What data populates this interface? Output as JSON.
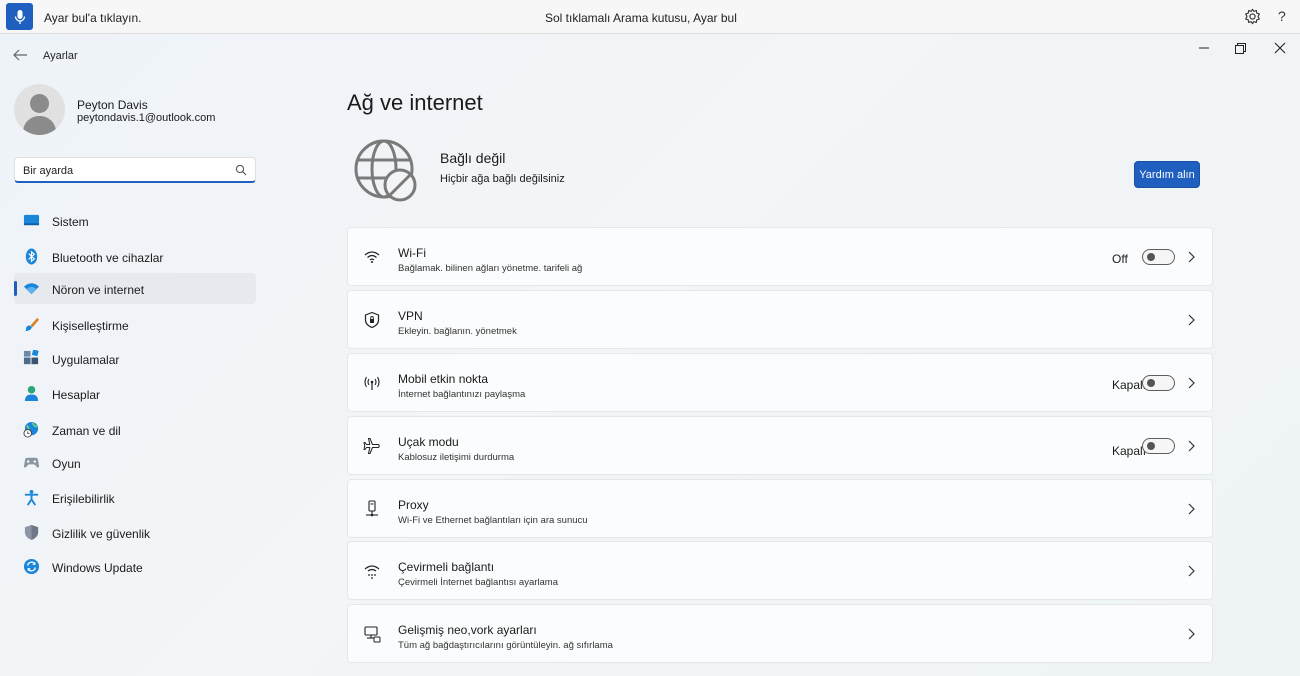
{
  "voice_bar": {
    "status_text": "Ayar bul'a tıklayın.",
    "center_text": "Sol tıklamalı Arama kutusu, Ayar bul",
    "help_label": "?"
  },
  "window": {
    "title": "Ayarlar"
  },
  "profile": {
    "name": "Peyton Davis",
    "email": "peytondavis.1@outlook.com"
  },
  "search": {
    "value": "Bir ayarda"
  },
  "sidebar": {
    "items": [
      {
        "label": "Sistem",
        "icon": "monitor-icon"
      },
      {
        "label": "Bluetooth ve cihazlar",
        "icon": "bluetooth-icon"
      },
      {
        "label": "Nöron ve internet",
        "icon": "wifi-icon",
        "active": true
      },
      {
        "label": "Kişiselleştirme",
        "icon": "brush-icon"
      },
      {
        "label": "Uygulamalar",
        "icon": "apps-icon"
      },
      {
        "label": "Hesaplar",
        "icon": "person-icon"
      },
      {
        "label": "Zaman ve dil",
        "icon": "globe-clock-icon"
      },
      {
        "label": "Oyun",
        "icon": "gamepad-icon"
      },
      {
        "label": "Erişilebilirlik",
        "icon": "accessibility-icon"
      },
      {
        "label": "Gizlilik ve güvenlik",
        "icon": "shield-icon"
      },
      {
        "label": "Windows Update",
        "icon": "update-icon"
      }
    ]
  },
  "main": {
    "title": "Ağ ve internet",
    "status_title": "Bağlı değil",
    "status_sub": "Hiçbir ağa bağlı değilsiniz",
    "help_button": "Yardım alın",
    "cards": [
      {
        "title": "Wi-Fi",
        "sub": "Bağlamak. bilinen ağları yönetme. tarifeli ağ",
        "toggle_label": "Off",
        "icon": "wifi-icon"
      },
      {
        "title": "VPN",
        "sub": "Ekleyin. bağlanın. yönetmek",
        "icon": "vpn-shield-icon"
      },
      {
        "title": "Mobil etkin nokta",
        "sub": "İnternet bağlantınızı paylaşma",
        "toggle_label": "Kapalı",
        "icon": "hotspot-icon"
      },
      {
        "title": "Uçak modu",
        "sub": "Kablosuz iletişimi durdurma",
        "toggle_label": "Kapalı",
        "icon": "airplane-icon"
      },
      {
        "title": "Proxy",
        "sub": "Wi-Fi ve Ethernet bağlantıları için ara sunucu",
        "icon": "proxy-icon"
      },
      {
        "title": "Çevirmeli bağlantı",
        "sub": "Çevirmeli İnternet bağlantısı ayarlama",
        "icon": "dialup-icon"
      },
      {
        "title": "Gelişmiş neo,vork ayarları",
        "sub": "Tüm ağ bağdaştırıcılarını görüntüleyin. ağ sıfırlama",
        "icon": "network-pc-icon"
      }
    ]
  },
  "colors": {
    "accent": "#1f5fbf",
    "active_nav_bg": "#e6eaee"
  }
}
